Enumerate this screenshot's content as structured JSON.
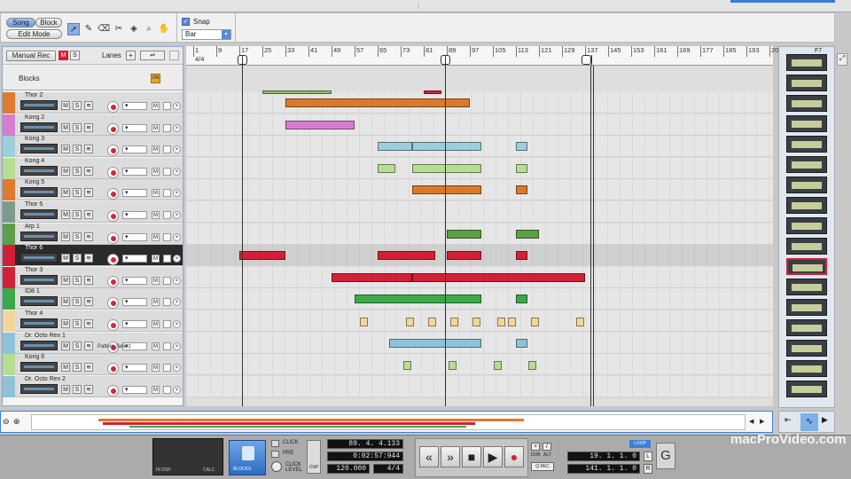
{
  "toolbar": {
    "song_label": "Song",
    "block_label": "Block",
    "edit_mode_label": "Edit Mode",
    "snap_label": "Snap",
    "snap_value": "Bar"
  },
  "sequencer": {
    "manual_rec_label": "Manual Rec",
    "lanes_label": "Lanes",
    "blocks_label": "Blocks",
    "pattern_select_label": "Pattern Select"
  },
  "ruler": {
    "time_sig": "4/4",
    "marks": [
      "1",
      "9",
      "17",
      "25",
      "33",
      "41",
      "49",
      "57",
      "65",
      "73",
      "81",
      "89",
      "97",
      "105",
      "113",
      "121",
      "129",
      "137",
      "145",
      "153",
      "161",
      "169",
      "177",
      "185",
      "193",
      "20"
    ]
  },
  "tracks": [
    {
      "name": "Thor 2",
      "color": "#e07a2c"
    },
    {
      "name": "Kong 2",
      "color": "#d77dd0"
    },
    {
      "name": "Kong 3",
      "color": "#9ccfd8"
    },
    {
      "name": "Kong 4",
      "color": "#b9dc93"
    },
    {
      "name": "Kong 5",
      "color": "#e07a2c"
    },
    {
      "name": "Thor 5",
      "color": "#7f9a8a"
    },
    {
      "name": "Arp 1",
      "color": "#5e9e47"
    },
    {
      "name": "Thor 6",
      "color": "#d42036"
    },
    {
      "name": "Thor 3",
      "color": "#d42036"
    },
    {
      "name": "ID8 1",
      "color": "#3ba94a"
    },
    {
      "name": "Thor 4",
      "color": "#f4d69a"
    },
    {
      "name": "Dr. Octo Rex 1",
      "color": "#8ec3d6"
    },
    {
      "name": "Kong 6",
      "color": "#b9dc93"
    },
    {
      "name": "Dr. Octo Rex 2",
      "color": "#8ec3d6"
    }
  ],
  "transport": {
    "position": "89. 4. 4.133",
    "time": "0:02:57:944",
    "tempo": "120.000",
    "signature": "4/4",
    "loop_label": "LOOP",
    "left_locator": "19. 1. 1.  0",
    "right_locator": "141. 1. 1.  0",
    "left_label": "L",
    "right_label": "R",
    "click_label": "CLICK",
    "pre_label": "PRE",
    "click_level_label": "CLICK LEVEL",
    "blocks_btn_label": "BLOCKS",
    "dub_label": "DUB",
    "alt_label": "ALT",
    "q_rec_label": "Q REC",
    "in_label": "IN DSP",
    "out_label": "OUT",
    "dsp_label": "DSP",
    "calc_label": "CALC",
    "rf7_label": "F7"
  },
  "watermark": {
    "line1": "macProVideo.com"
  }
}
